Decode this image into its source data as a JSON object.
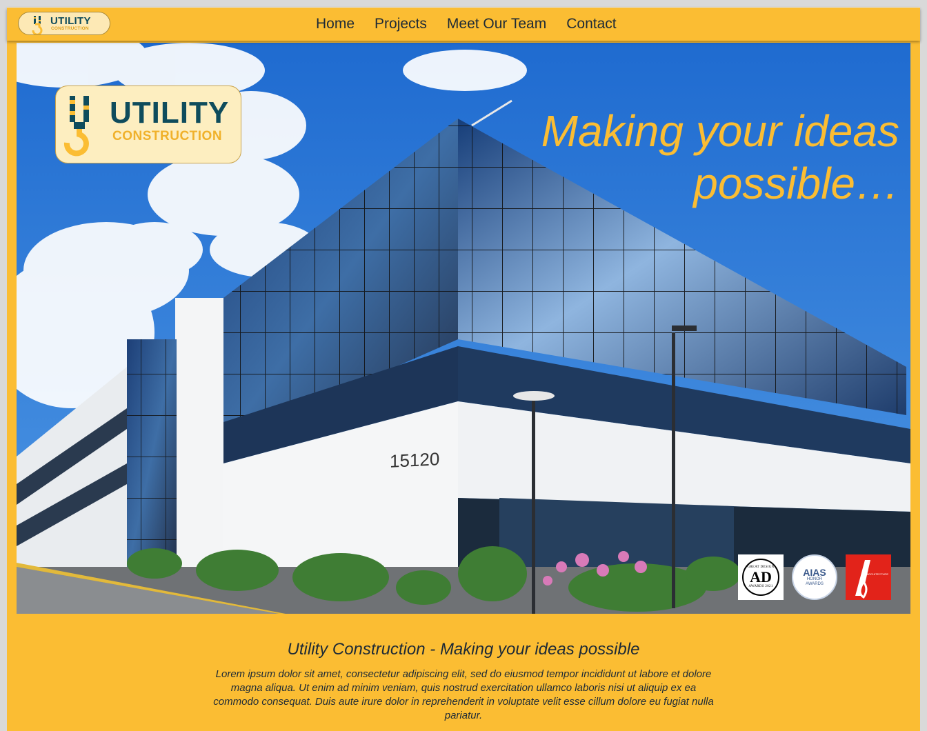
{
  "brand": {
    "name": "UTILITY",
    "sub": "CONSTRUCTION",
    "colors": {
      "primary": "#fbbd33",
      "dark": "#0f4c5c",
      "text": "#1d2a36"
    }
  },
  "nav": {
    "links": [
      "Home",
      "Projects",
      "Meet Our Team",
      "Contact"
    ]
  },
  "hero": {
    "tagline": "Making your ideas possible…",
    "building_number": "15120",
    "awards": {
      "ad": {
        "top": "GREAT DESIGN",
        "mark": "AD",
        "bottom": "AWARDS 2021"
      },
      "aias": {
        "mark": "AIAS",
        "line1": "HONOR",
        "line2": "AWARDS"
      },
      "arch": {
        "mark": "ARCHITECTURE"
      }
    }
  },
  "content": {
    "title": "Utility Construction - Making your ideas possible",
    "body": "Lorem ipsum dolor sit amet, consectetur adipiscing elit, sed do eiusmod tempor incididunt ut labore et dolore magna aliqua. Ut enim ad minim veniam, quis nostrud exercitation ullamco laboris nisi ut aliquip ex ea commodo consequat. Duis aute irure dolor in reprehenderit in voluptate velit esse cillum dolore eu fugiat nulla pariatur."
  }
}
